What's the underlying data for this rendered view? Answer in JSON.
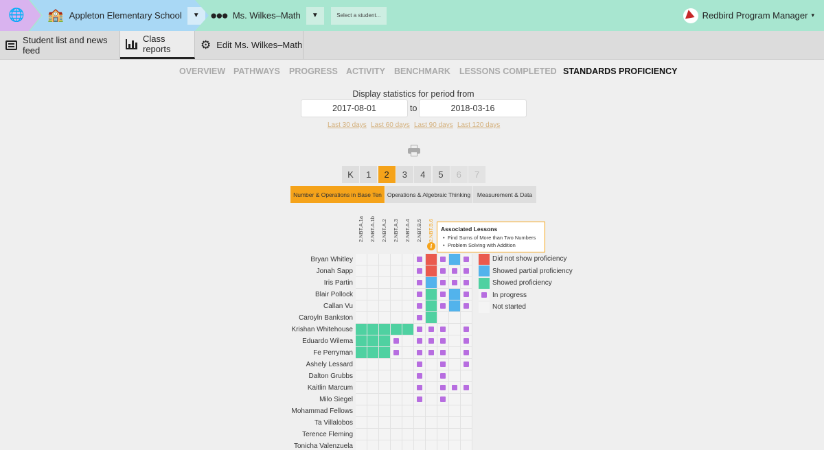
{
  "topbar": {
    "globe_icon": "globe-icon",
    "school_icon": "school-icon",
    "school_name": "Appleton Elementary School",
    "class_icon": "people-icon",
    "class_name": "Ms. Wilkes–Math",
    "dropdown_glyph": "▼",
    "student_select_placeholder": "Select a student...",
    "user_name": "Redbird Program Manager",
    "user_caret": "▾",
    "colors": {
      "bar": "#a8e6d0",
      "globe": "#d9b3ef",
      "school": "#a9d8f5"
    }
  },
  "tabs": {
    "news": "Student list and news feed",
    "reports": "Class reports",
    "edit": "Edit Ms. Wilkes–Math"
  },
  "report_tabs": [
    "OVERVIEW",
    "PATHWAYS",
    "PROGRESS",
    "ACTIVITY",
    "BENCHMARK",
    "LESSONS COMPLETED",
    "STANDARDS PROFICIENCY"
  ],
  "report_active": "STANDARDS PROFICIENCY",
  "period": {
    "title": "Display statistics for period from",
    "from": "2017-08-01",
    "to_label": "to",
    "to": "2018-03-16",
    "quick": [
      "Last 30 days",
      "Last 60 days",
      "Last 90 days",
      "Last 120 days"
    ]
  },
  "grades": [
    "K",
    "1",
    "2",
    "3",
    "4",
    "5",
    "6",
    "7"
  ],
  "grade_active": "2",
  "grades_disabled": [
    "6",
    "7"
  ],
  "domains": [
    "Number & Operations in Base Ten",
    "Operations & Algebraic Thinking",
    "Measurement & Data"
  ],
  "domain_active": "Number & Operations in Base Ten",
  "standards": [
    "2.NBT.A.1a",
    "2.NBT.A.1b",
    "2.NBT.A.2",
    "2.NBT.A.3",
    "2.NBT.A.4",
    "2.NBT.B.5",
    "2.NBT.B.6",
    "",
    "",
    ""
  ],
  "standard_active": "2.NBT.B.6",
  "info_icon": "i",
  "tooltip": {
    "title": "Associated Lessons",
    "items": [
      "Find Sums of More than Two Numbers",
      "Problem Solving with Addition"
    ]
  },
  "legend": [
    {
      "key": "red",
      "label": "Did not show proficiency"
    },
    {
      "key": "blue",
      "label": "Showed partial proficiency"
    },
    {
      "key": "green",
      "label": "Showed proficiency"
    },
    {
      "key": "prog",
      "label": "In progress"
    },
    {
      "key": "none",
      "label": "Not started"
    }
  ],
  "status_colors": {
    "red": "#ea5a4d",
    "blue": "#52b3ec",
    "green": "#4fd1a1",
    "prog": "#b76de0",
    "none": "#f4f4f4"
  },
  "students": [
    {
      "name": "Bryan Whitley",
      "cells": [
        "",
        "",
        "",
        "",
        "",
        "prog",
        "red",
        "prog",
        "blue",
        "prog"
      ]
    },
    {
      "name": "Jonah Sapp",
      "cells": [
        "",
        "",
        "",
        "",
        "",
        "prog",
        "red",
        "prog",
        "prog",
        "prog"
      ]
    },
    {
      "name": "Iris Partin",
      "cells": [
        "",
        "",
        "",
        "",
        "",
        "prog",
        "blue",
        "prog",
        "prog",
        "prog"
      ]
    },
    {
      "name": "Blair Pollock",
      "cells": [
        "",
        "",
        "",
        "",
        "",
        "prog",
        "green",
        "prog",
        "blue",
        "prog"
      ]
    },
    {
      "name": "Callan Vu",
      "cells": [
        "",
        "",
        "",
        "",
        "",
        "prog",
        "green",
        "prog",
        "blue",
        "prog"
      ]
    },
    {
      "name": "Caroyln Bankston",
      "cells": [
        "",
        "",
        "",
        "",
        "",
        "prog",
        "green",
        "",
        "",
        ""
      ]
    },
    {
      "name": "Krishan Whitehouse",
      "cells": [
        "green",
        "green",
        "green",
        "green",
        "green",
        "prog",
        "prog",
        "prog",
        "",
        "prog"
      ]
    },
    {
      "name": "Eduardo Wilema",
      "cells": [
        "green",
        "green",
        "green",
        "prog",
        "",
        "prog",
        "prog",
        "prog",
        "",
        "prog"
      ]
    },
    {
      "name": "Fe Perryman",
      "cells": [
        "green",
        "green",
        "green",
        "prog",
        "",
        "prog",
        "prog",
        "prog",
        "",
        "prog"
      ]
    },
    {
      "name": "Ashely Lessard",
      "cells": [
        "",
        "",
        "",
        "",
        "",
        "prog",
        "",
        "prog",
        "",
        "prog"
      ]
    },
    {
      "name": "Dalton Grubbs",
      "cells": [
        "",
        "",
        "",
        "",
        "",
        "prog",
        "",
        "prog",
        "",
        ""
      ]
    },
    {
      "name": "Kaitlin Marcum",
      "cells": [
        "",
        "",
        "",
        "",
        "",
        "prog",
        "",
        "prog",
        "prog",
        "prog"
      ]
    },
    {
      "name": "Milo Siegel",
      "cells": [
        "",
        "",
        "",
        "",
        "",
        "prog",
        "",
        "prog",
        "",
        ""
      ]
    },
    {
      "name": "Mohammad Fellows",
      "cells": [
        "",
        "",
        "",
        "",
        "",
        "",
        "",
        "",
        "",
        ""
      ]
    },
    {
      "name": "Ta Villalobos",
      "cells": [
        "",
        "",
        "",
        "",
        "",
        "",
        "",
        "",
        "",
        ""
      ]
    },
    {
      "name": "Terence Fleming",
      "cells": [
        "",
        "",
        "",
        "",
        "",
        "",
        "",
        "",
        "",
        ""
      ]
    },
    {
      "name": "Tonicha Valenzuela",
      "cells": [
        "",
        "",
        "",
        "",
        "",
        "",
        "",
        "",
        "",
        ""
      ]
    }
  ]
}
